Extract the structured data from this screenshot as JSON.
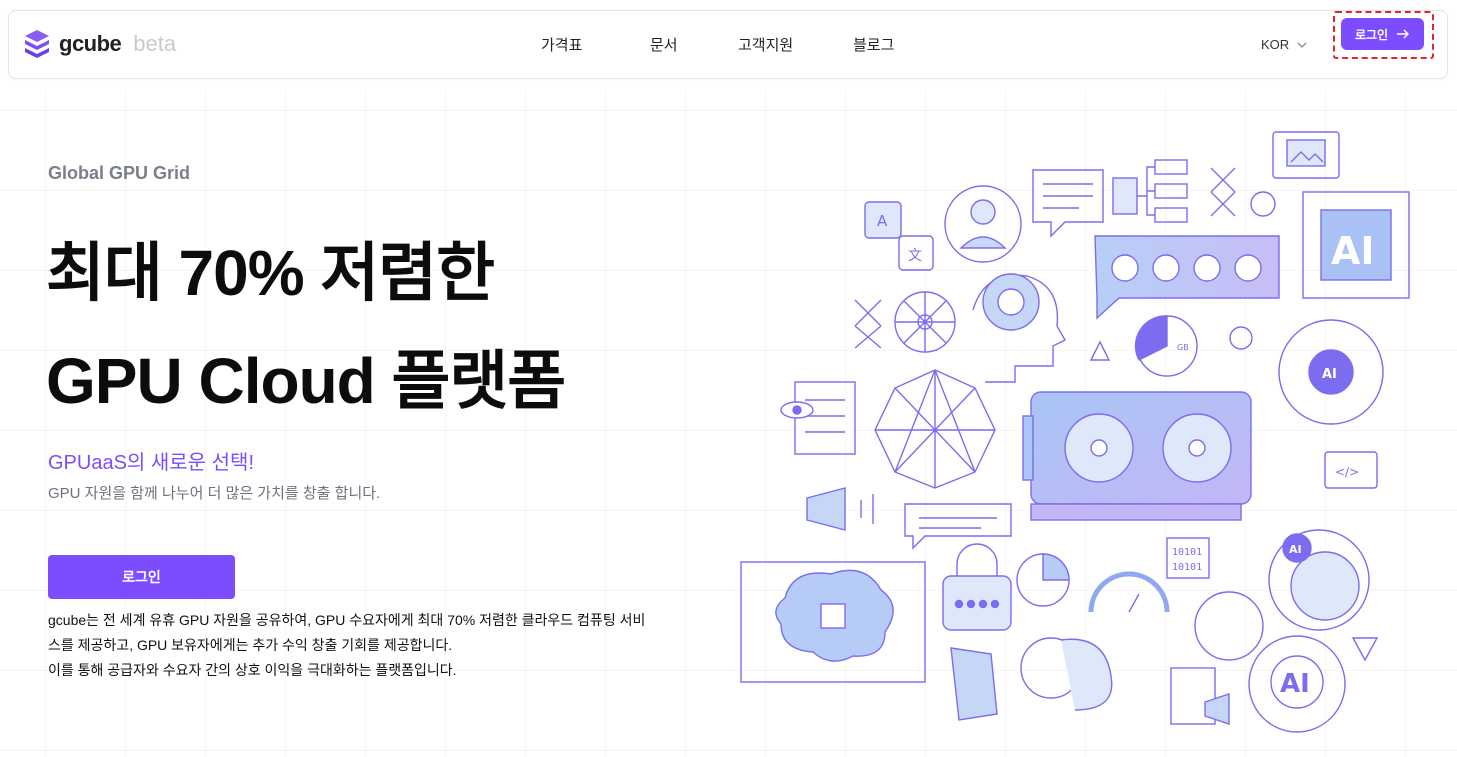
{
  "brand": {
    "name": "gcube",
    "badge": "beta",
    "accent": "#7c4dff"
  },
  "nav": {
    "items": [
      "가격표",
      "문서",
      "고객지원",
      "블로그"
    ]
  },
  "lang": {
    "label": "KOR"
  },
  "header": {
    "login_label": "로그인"
  },
  "hero": {
    "eyebrow": "Global GPU Grid",
    "title_line1": "최대 70% 저렴한",
    "title_line2": "GPU Cloud 플랫폼",
    "subtitle": "GPUaaS의 새로운 선택!",
    "description": "GPU 자원을 함께 나누어 더 많은 가치를 창출 합니다.",
    "cta_label": "로그인",
    "body_line1": "gcube는 전 세계 유휴 GPU 자원을 공유하여, GPU 수요자에게 최대 70% 저렴한 클라우드 컴퓨팅 서비",
    "body_line2": "스를 제공하고, GPU 보유자에게는 추가 수익 창출 기회를 제공합니다.",
    "body_line3": "이를 통해 공급자와 수요자 간의 상호 이익을 극대화하는 플랫폼입니다."
  },
  "illustration": {
    "ai_label": "AI",
    "gb_label": "GB",
    "binary_line1": "10101",
    "binary_line2": "10101",
    "code_label": "</>"
  }
}
